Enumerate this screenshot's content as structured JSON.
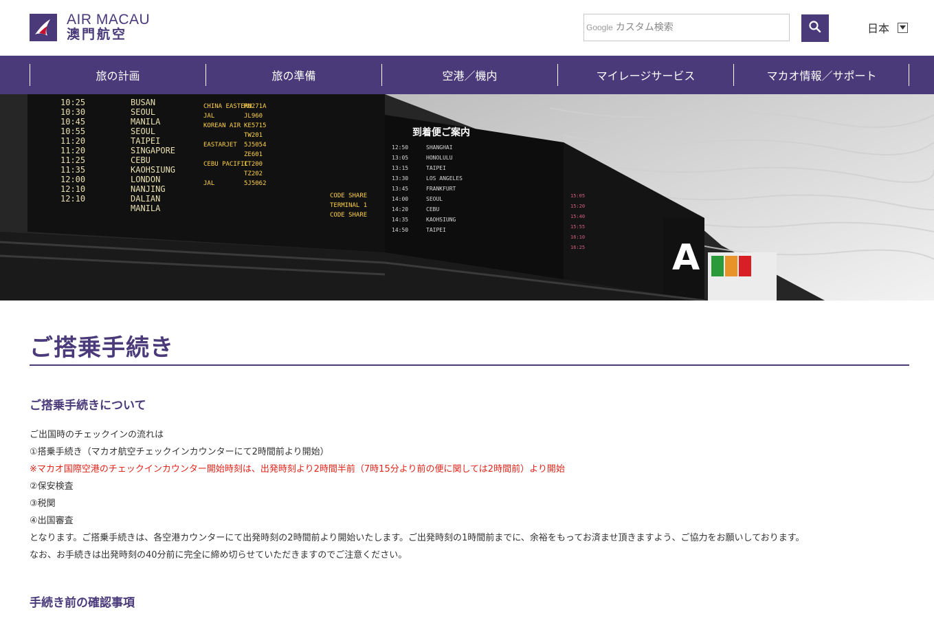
{
  "header": {
    "logo_en": "AIR MACAU",
    "logo_cn": "澳門航空",
    "search_prefix": "Google",
    "search_placeholder": "カスタム検索",
    "search_icon": "search-icon",
    "language": "日本",
    "brand_color": "#4a3a7a"
  },
  "nav": {
    "items": [
      {
        "label": "旅の計画"
      },
      {
        "label": "旅の準備"
      },
      {
        "label": "空港／機内"
      },
      {
        "label": "マイレージサービス"
      },
      {
        "label": "マカオ情報／サポート"
      }
    ]
  },
  "hero": {
    "image": "airport departure and arrival board",
    "board_title": "到着便ご案内",
    "gate_letter": "A"
  },
  "main": {
    "title": "ご搭乗手続き",
    "section1": {
      "heading": "ご搭乗手続きについて",
      "lines": [
        "ご出国時のチェックインの流れは",
        "①搭乗手続き（マカオ航空チェックインカウンターにて2時間前より開始）",
        "※マカオ国際空港のチェックインカウンター開始時刻は、出発時刻より2時間半前（7時15分より前の便に関しては2時間前）より開始",
        "②保安検査",
        "③税関",
        "④出国審査",
        "となります。ご搭乗手続きは、各空港カウンターにて出発時刻の2時間前より開始いたします。ご出発時刻の1時間前までに、余裕をもってお済ませ頂きますよう、ご協力をお願いしております。",
        "なお、お手続きは出発時刻の40分前に完全に締め切らせていただきますのでご注意ください。"
      ],
      "notice_color": "#e0251b"
    },
    "section2": {
      "heading": "手続き前の確認事項"
    }
  }
}
